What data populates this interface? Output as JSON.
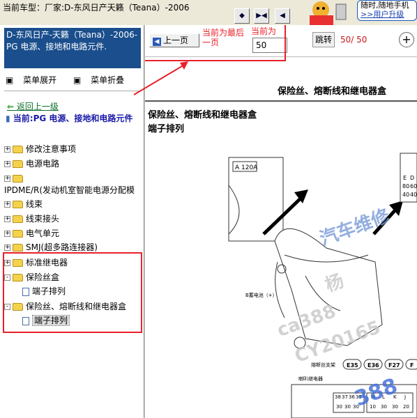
{
  "window": {
    "title": "当前车型：厂家:D-东风日产天籁（Teana）-2006"
  },
  "promo": {
    "line1": "随时,随地手机",
    "line2": ">>用户升级"
  },
  "sidebar": {
    "selected_header": "D-东风日产-天籁（Teana）-2006- PG 电源、接地和电路元件.",
    "expand_all": "菜单展开",
    "collapse_all": "菜单折叠",
    "back_link": "返回上一级",
    "current_label": "当前:PG 电源、接地和电路元件",
    "tree": [
      {
        "label": "修改注意事项",
        "type": "folder",
        "expander": "+"
      },
      {
        "label": "电源电路",
        "type": "folder",
        "expander": "+"
      },
      {
        "label": "",
        "type": "folder",
        "expander": "+"
      },
      {
        "label": "IPDME/R(发动机室智能电源分配模",
        "type": "text",
        "expander": ""
      },
      {
        "label": "线束",
        "type": "folder",
        "expander": "+"
      },
      {
        "label": "线束接头",
        "type": "folder",
        "expander": "+"
      },
      {
        "label": "电气单元",
        "type": "folder",
        "expander": "+"
      },
      {
        "label": "SMJ(超多路连接器)",
        "type": "folder",
        "expander": "+"
      },
      {
        "label": "标准继电器",
        "type": "folder",
        "expander": "+"
      },
      {
        "label": "保险丝盒",
        "type": "folder",
        "expander": "-"
      },
      {
        "label": "端子排列",
        "type": "doc",
        "expander": ""
      },
      {
        "label": "保险丝、熔断线和继电器盒",
        "type": "folder",
        "expander": "-"
      },
      {
        "label": "端子排列",
        "type": "doc",
        "expander": ""
      }
    ]
  },
  "toolbar": {
    "prev_label": "上一页",
    "note_current_page": "当前为最后一页",
    "note_current": "当前为",
    "page_value": "50",
    "jump_label": "跳转",
    "page_count": "50/ 50"
  },
  "document": {
    "title": "保险丝、熔断线和继电器盒",
    "section_title": "保险丝、熔断线和继电器盒",
    "section_subtitle": "端子排列",
    "label_battery": "B蓄电池（+）",
    "label_fuse_holder": "熔断丝支架",
    "label_horn_relay": "喇叭继电器",
    "fuse_a": "A",
    "fuse_a_value": "120A",
    "conn_codes": [
      "E35",
      "E36",
      "F27",
      "F"
    ],
    "relay_row1": [
      "38",
      "37",
      "36",
      "35"
    ],
    "relay_row2": [
      "30",
      "30",
      "30"
    ],
    "relay_row_r1": [
      "M",
      "L",
      "K",
      "J"
    ],
    "relay_row_r2": [
      "10",
      "30",
      "30",
      "20"
    ],
    "side_table": [
      "E",
      "80",
      "40"
    ],
    "side_table_r": [
      "D",
      "60",
      "40"
    ]
  },
  "watermarks": [
    "汽车维修",
    "杨",
    "ca388",
    "CY20165",
    "388"
  ]
}
